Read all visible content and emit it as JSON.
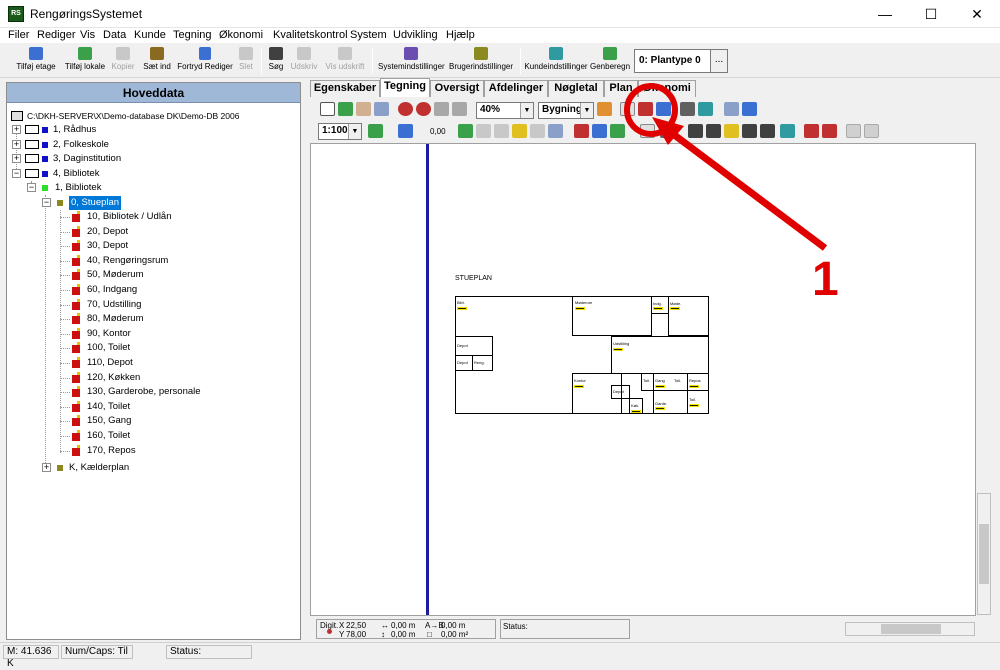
{
  "window": {
    "title": "RengøringsSystemet",
    "app_icon_text": "RS",
    "minimize": "—",
    "maximize": "☐",
    "close": "✕"
  },
  "menu": [
    "Filer",
    "Rediger",
    "Vis",
    "Data",
    "Kunde",
    "Tegning",
    "Økonomi",
    "Kvalitetskontrol",
    "System",
    "Udvikling",
    "Hjælp"
  ],
  "toolbar": {
    "tilfoej_etage": "Tilføj etage",
    "tilfoej_lokale": "Tilføj lokale",
    "kopier": "Kopier",
    "saet_ind": "Sæt ind",
    "fortryd": "Fortryd Rediger",
    "slet": "Slet",
    "soeg": "Søg",
    "udskriv": "Udskriv",
    "vis_udskrift": "Vis udskrift",
    "systemindstillinger": "Systemindstillinger",
    "brugerindstillinger": "Brugerindstillinger",
    "kundeindstillinger": "Kundeindstillinger",
    "genberegn": "Genberegn",
    "plantype": "0: Plantype 0",
    "plantype_more": "...",
    "colors": {
      "blue": "#3b6fd1",
      "green": "#3aa04a",
      "gray": "#a8a8a8",
      "red": "#c03030",
      "purple": "#6b4fb0",
      "olive": "#8a8a20",
      "teal": "#2f9aa0"
    }
  },
  "left": {
    "header": "Hoveddata",
    "root": "C:\\DKH-SERVER\\X\\Demo-database DK\\Demo-DB 2006",
    "buildings": [
      "1, Rådhus",
      "2, Folkeskole",
      "3, Daginstitution",
      "4, Bibliotek"
    ],
    "sub_building": "1, Bibliotek",
    "floor_selected": "0, Stueplan",
    "rooms": [
      "10, Bibliotek / Udlån",
      "20, Depot",
      "30, Depot",
      "40, Rengøringsrum",
      "50, Møderum",
      "60, Indgang",
      "70, Udstilling",
      "80, Møderum",
      "90, Kontor",
      "100, Toilet",
      "110, Depot",
      "120, Køkken",
      "130, Garderobe, personale",
      "140, Toilet",
      "150, Gang",
      "160, Toilet",
      "170, Repos"
    ],
    "floor_other": "K, Kælderplan",
    "exp_plus": "+",
    "exp_minus": "−"
  },
  "tabs": [
    "Egenskaber",
    "Tegning",
    "Oversigt",
    "Afdelinger",
    "Nøgletal",
    "Plan",
    "Økonomi"
  ],
  "drawing_toolbar": {
    "zoom": "40%",
    "building": "Bygning",
    "scale": "1:100",
    "line_width": "0,00",
    "dd": "▼"
  },
  "canvas": {
    "floor_title": "STUEPLAN",
    "room_labels": [
      "Bibl.",
      "Møderum",
      "Indg.",
      "Møde.",
      "Depot",
      "Udstilling",
      "Depot",
      "Reng.",
      "Kontor",
      "Depot",
      "Toil.",
      "Gang",
      "Toil.",
      "Repos",
      "Garde.",
      "Køk.",
      "Toil."
    ]
  },
  "status_drawing": {
    "digit_label": "Digit.",
    "x_label": "X",
    "x": "22,50",
    "y_label": "Y",
    "y": "78,00",
    "dx_label": "↔",
    "dx": "0,00 m",
    "dy_label": "↕",
    "dy": "0,00 m",
    "len_label": "A→B",
    "len": "0,00 m",
    "area_label": "□",
    "area": "0,00 m²",
    "state": "Status:"
  },
  "statusbar": {
    "memory": "M: 41.636 K",
    "numcaps": "Num/Caps: Til",
    "status": "Status:"
  },
  "annotation": {
    "number": "1",
    "color": "#e00000"
  }
}
